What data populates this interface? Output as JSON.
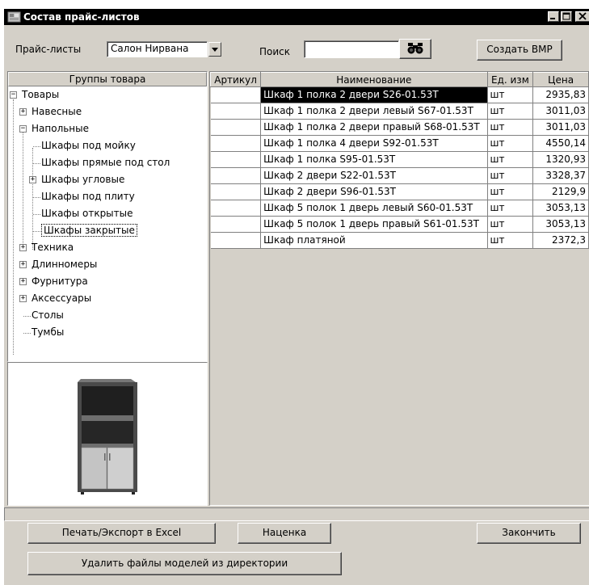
{
  "window": {
    "title": "Состав прайс-листов"
  },
  "toolbar": {
    "price_list_label": "Прайс-листы",
    "price_list_value": "Салон Нирвана",
    "search_label": "Поиск",
    "search_value": "",
    "create_bmp_label": "Создать BMP"
  },
  "tree": {
    "header": "Группы товара",
    "nodes": [
      {
        "label": "Товары",
        "expander": "−"
      },
      {
        "label": "Навесные",
        "expander": "+"
      },
      {
        "label": "Напольные",
        "expander": "−"
      },
      {
        "label": "Шкафы под мойку"
      },
      {
        "label": "Шкафы прямые под стол"
      },
      {
        "label": "Шкафы угловые",
        "expander": "+"
      },
      {
        "label": "Шкафы под плиту"
      },
      {
        "label": "Шкафы открытые"
      },
      {
        "label": "Шкафы закрытые",
        "selected": true
      },
      {
        "label": "Техника",
        "expander": "+"
      },
      {
        "label": "Длинномеры",
        "expander": "+"
      },
      {
        "label": "Фурнитура",
        "expander": "+"
      },
      {
        "label": "Аксессуары",
        "expander": "+"
      },
      {
        "label": "Столы"
      },
      {
        "label": "Тумбы"
      }
    ]
  },
  "table": {
    "columns": [
      "Артикул",
      "Наименование",
      "Ед. изм",
      "Цена"
    ],
    "rows": [
      {
        "sku": "",
        "name": "Шкаф 1 полка 2 двери S26-01.53T",
        "unit": "шт",
        "price": "2935,83"
      },
      {
        "sku": "",
        "name": "Шкаф 1 полка 2 двери левый S67-01.53T",
        "unit": "шт",
        "price": "3011,03"
      },
      {
        "sku": "",
        "name": "Шкаф 1 полка 2 двери правый S68-01.53T",
        "unit": "шт",
        "price": "3011,03"
      },
      {
        "sku": "",
        "name": "Шкаф 1 полка 4 двери S92-01.53T",
        "unit": "шт",
        "price": "4550,14"
      },
      {
        "sku": "",
        "name": "Шкаф 1 полка S95-01.53T",
        "unit": "шт",
        "price": "1320,93"
      },
      {
        "sku": "",
        "name": "Шкаф 2 двери S22-01.53T",
        "unit": "шт",
        "price": "3328,37"
      },
      {
        "sku": "",
        "name": "Шкаф 2 двери S96-01.53T",
        "unit": "шт",
        "price": "2129,9"
      },
      {
        "sku": "",
        "name": "Шкаф 5 полок 1 дверь левый S60-01.53T",
        "unit": "шт",
        "price": "3053,13"
      },
      {
        "sku": "",
        "name": "Шкаф 5 полок 1 дверь правый S61-01.53T",
        "unit": "шт",
        "price": "3053,13"
      },
      {
        "sku": "",
        "name": "Шкаф платяной",
        "unit": "шт",
        "price": "2372,3"
      }
    ]
  },
  "buttons": {
    "print_export": "Печать/Экспорт в Excel",
    "markup": "Наценка",
    "finish": "Закончить",
    "delete_models": "Удалить файлы моделей из директории"
  }
}
